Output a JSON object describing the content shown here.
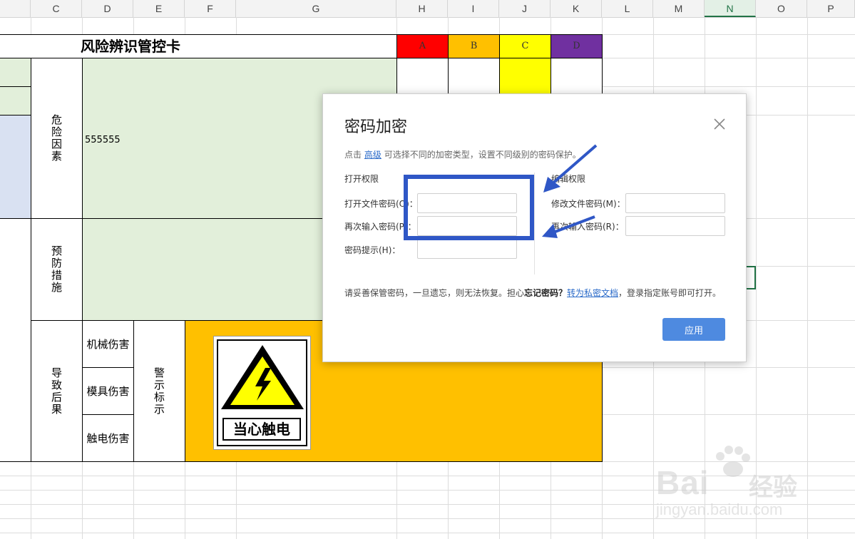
{
  "columns": [
    "C",
    "D",
    "E",
    "F",
    "G",
    "H",
    "I",
    "J",
    "K",
    "L",
    "M",
    "N",
    "O",
    "P"
  ],
  "active_column": "N",
  "card": {
    "title": "风险辨识管控卡",
    "grades": [
      {
        "label": "A",
        "color": "#ff0000"
      },
      {
        "label": "B",
        "color": "#ffc000"
      },
      {
        "label": "C",
        "color": "#ffff00"
      },
      {
        "label": "D",
        "color": "#7030a0"
      }
    ],
    "hazard_label": "危险因素",
    "hazard_value": "555555",
    "prevention_label": "预防措施",
    "consequence_label": "导致后果",
    "consequences": [
      "机械伤害",
      "模具伤害",
      "触电伤害"
    ],
    "warning_label": "警示标示",
    "sign_text": "当心触电"
  },
  "dialog": {
    "title": "密码加密",
    "close_icon": "close-icon",
    "hint_before": "点击",
    "hint_link": "高级",
    "hint_after": "可选择不同的加密类型，设置不同级别的密码保护。",
    "open_section": "打开权限",
    "edit_section": "编辑权限",
    "open_password_label": "打开文件密码(O)：",
    "open_confirm_label": "再次输入密码(P)：",
    "password_hint_label": "密码提示(H)：",
    "edit_password_label": "修改文件密码(M)：",
    "edit_confirm_label": "再次输入密码(R)：",
    "open_password_value": "",
    "open_confirm_value": "",
    "password_hint_value": "",
    "edit_password_value": "",
    "edit_confirm_value": "",
    "note_before": "请妥善保管密码，一旦遗忘，则无法恢复。担心",
    "note_bold": "忘记密码？",
    "note_link": "转为私密文档",
    "note_after": "，登录指定账号即可打开。",
    "apply_label": "应用"
  },
  "watermark": {
    "brand": "Bai",
    "brand_tail": "经验",
    "url": "jingyan.baidu.com"
  },
  "colors": {
    "green_fill": "#e2efda",
    "blue_fill": "#d9e1f2",
    "orange_fill": "#ffc000",
    "annotation": "#2f57c6",
    "apply_button": "#4e8ae0"
  }
}
